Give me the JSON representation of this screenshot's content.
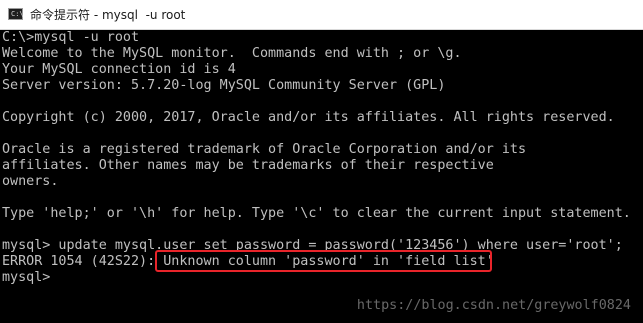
{
  "window": {
    "title": "命令提示符 - mysql  -u root",
    "icon": "console-icon"
  },
  "console": {
    "lines": [
      "C:\\>mysql -u root",
      "Welcome to the MySQL monitor.  Commands end with ; or \\g.",
      "Your MySQL connection id is 4",
      "Server version: 5.7.20-log MySQL Community Server (GPL)",
      "",
      "Copyright (c) 2000, 2017, Oracle and/or its affiliates. All rights reserved.",
      "",
      "Oracle is a registered trademark of Oracle Corporation and/or its",
      "affiliates. Other names may be trademarks of their respective",
      "owners.",
      "",
      "Type 'help;' or '\\h' for help. Type '\\c' to clear the current input statement.",
      "",
      "mysql> update mysql.user set password = password('123456') where user='root';",
      "ERROR 1054 (42S22): Unknown column 'password' in 'field list'",
      "mysql>"
    ]
  },
  "watermark": "https://blog.csdn.net/greywolf0824",
  "colors": {
    "console_bg": "#000000",
    "console_text": "#c0c0c0",
    "highlight": "#e8242a"
  }
}
